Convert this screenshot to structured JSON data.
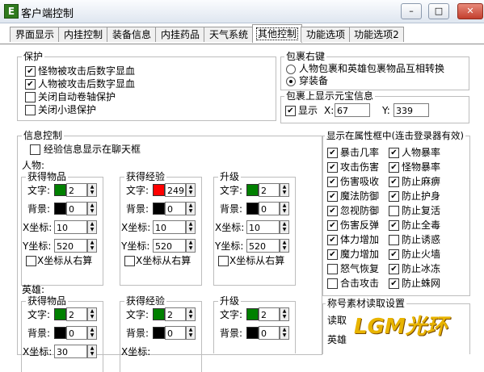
{
  "window": {
    "title": "客户端控制",
    "icon": "E",
    "min": "–",
    "max": "□",
    "close": "✕"
  },
  "tabs": [
    "界面显示",
    "内挂控制",
    "装备信息",
    "内挂药品",
    "天气系统",
    "其他控制",
    "功能选项",
    "功能选项2"
  ],
  "protect": {
    "title": "保护",
    "items": [
      "怪物被攻击后数字显血",
      "人物被攻击后数字显血",
      "关闭自动卷轴保护",
      "关闭小退保护"
    ],
    "checked": [
      true,
      true,
      false,
      false
    ]
  },
  "bag": {
    "title": "包裹右键",
    "options": [
      "人物包裹和英雄包裹物品互相转换",
      "穿装备"
    ],
    "selected": 1
  },
  "gold": {
    "title": "包裹上显示元宝信息",
    "show_label": "显示",
    "show": true,
    "x_label": "X:",
    "x": "67",
    "y_label": "Y:",
    "y": "339"
  },
  "info": {
    "title": "信息控制",
    "exp_chat": "经验信息显示在聊天框",
    "exp_chat_checked": false
  },
  "player": {
    "label": "人物:",
    "get_item": {
      "title": "获得物品",
      "text_lbl": "文字:",
      "text_val": "2",
      "text_color": "#008000",
      "bg_lbl": "背景:",
      "bg_val": "0",
      "bg_color": "#000000",
      "x_lbl": "X坐标:",
      "x": "10",
      "y_lbl": "Y坐标:",
      "y": "520",
      "right": "X坐标从右算"
    },
    "get_exp": {
      "title": "获得经验",
      "text_lbl": "文字:",
      "text_val": "249",
      "text_color": "#ff0000",
      "bg_lbl": "背景:",
      "bg_val": "0",
      "bg_color": "#000000",
      "x_lbl": "X坐标:",
      "x": "10",
      "y_lbl": "Y坐标:",
      "y": "520",
      "right": "X坐标从右算"
    },
    "level": {
      "title": "升级",
      "text_lbl": "文字:",
      "text_val": "2",
      "text_color": "#008000",
      "bg_lbl": "背景:",
      "bg_val": "0",
      "bg_color": "#000000",
      "x_lbl": "X坐标:",
      "x": "10",
      "y_lbl": "Y坐标:",
      "y": "520",
      "right": "X坐标从右算"
    }
  },
  "hero": {
    "label": "英雄:",
    "get_item": {
      "title": "获得物品",
      "text_lbl": "文字:",
      "text_val": "2",
      "text_color": "#008000",
      "bg_lbl": "背景:",
      "bg_val": "0",
      "bg_color": "#000000",
      "x_lbl": "X坐标:",
      "x": "30"
    },
    "get_exp": {
      "title": "获得经验",
      "text_lbl": "文字:",
      "text_val": "2",
      "text_color": "#008000",
      "bg_lbl": "背景:",
      "bg_val": "0",
      "bg_color": "#000000",
      "x_lbl": "X坐标:"
    },
    "level": {
      "title": "升级",
      "text_lbl": "文字:",
      "text_val": "2",
      "text_color": "#008000",
      "bg_lbl": "背景:",
      "bg_val": "0",
      "bg_color": "#000000"
    }
  },
  "attr": {
    "title": "显示在属性框中(连击登录器有效)",
    "left": [
      "暴击几率",
      "攻击伤害",
      "伤害吸收",
      "魔法防御",
      "忽视防御",
      "伤害反弹",
      "体力增加",
      "魔力增加",
      "怒气恢复",
      "合击攻击"
    ],
    "left_checked": [
      true,
      true,
      true,
      true,
      true,
      true,
      true,
      true,
      false,
      false
    ],
    "right": [
      "人物暴率",
      "怪物暴率",
      "防止麻痹",
      "防止护身",
      "防止复活",
      "防止全毒",
      "防止诱惑",
      "防止火墙",
      "防止冰冻",
      "防止蛛网"
    ],
    "right_checked": [
      true,
      true,
      true,
      true,
      false,
      true,
      false,
      true,
      true,
      true
    ]
  },
  "material": {
    "title": "称号素材读取设置",
    "read_lbl": "读取",
    "hero_lbl": "英雄"
  },
  "watermark": "LGM光环"
}
